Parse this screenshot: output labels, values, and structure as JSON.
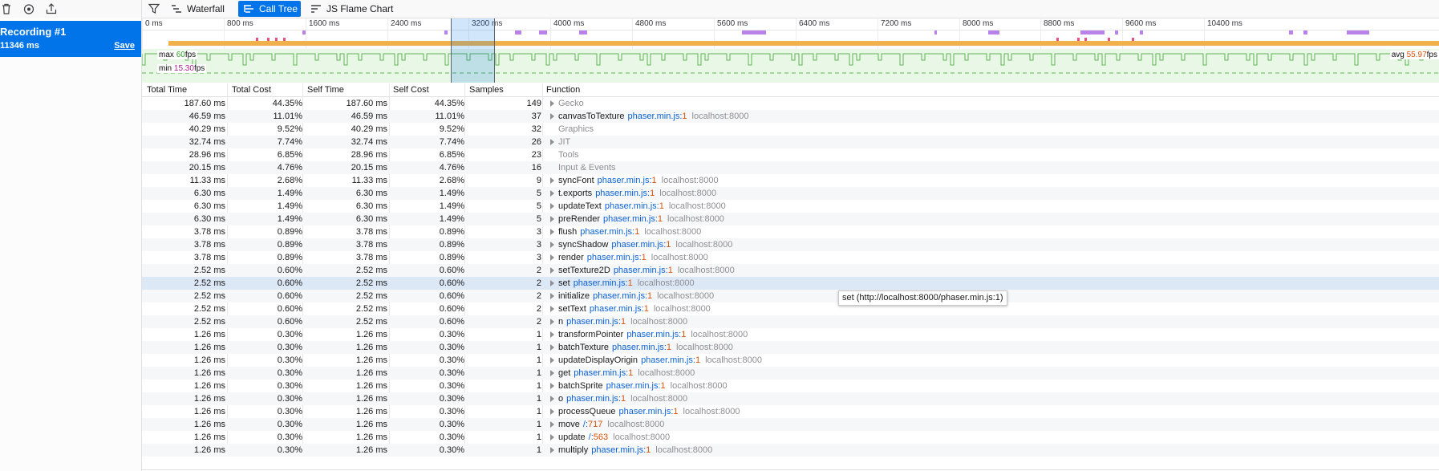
{
  "sidebar": {
    "toolbar_icons": [
      "trash-icon",
      "record-icon",
      "import-icon"
    ],
    "recording": {
      "title": "Recording #1",
      "duration": "11346 ms",
      "save_label": "Save"
    }
  },
  "toolbar": {
    "filter_icon": "filter-icon",
    "tabs": [
      {
        "label": "Waterfall",
        "icon": "waterfall-icon",
        "selected": false
      },
      {
        "label": "Call Tree",
        "icon": "call-tree-icon",
        "selected": true
      },
      {
        "label": "JS Flame Chart",
        "icon": "flame-chart-icon",
        "selected": false
      }
    ]
  },
  "overview": {
    "ticks": [
      "0 ms",
      "800 ms",
      "1600 ms",
      "2400 ms",
      "3200 ms",
      "4000 ms",
      "4800 ms",
      "5600 ms",
      "6400 ms",
      "7200 ms",
      "8000 ms",
      "8800 ms",
      "9600 ms",
      "10400 ms"
    ],
    "fps": {
      "max_label": "max",
      "max_value": "60",
      "min_label": "min",
      "min_value": "15.30",
      "avg_label": "avg",
      "avg_value": "55.97",
      "unit": "fps"
    },
    "selection_start_ms": 3025,
    "selection_end_ms": 3455,
    "colors": {
      "marker_bar": "#f0b14c",
      "marker_purple": "#b982e8",
      "marker_red": "#e5537c",
      "fps_fill": "#e8f7e6",
      "selection": "#0074e8"
    }
  },
  "calltree": {
    "headers": {
      "total_time": "Total Time",
      "total_cost": "Total Cost",
      "self_time": "Self Time",
      "self_cost": "Self Cost",
      "samples": "Samples",
      "function": "Function"
    },
    "rows": [
      {
        "total_time": "187.60 ms",
        "total_cost": "44.35%",
        "self_time": "187.60 ms",
        "self_cost": "44.35%",
        "samples": "149",
        "name": "Gecko",
        "file": "",
        "line": "",
        "host": "",
        "category": true,
        "twisty": true
      },
      {
        "total_time": "46.59 ms",
        "total_cost": "11.01%",
        "self_time": "46.59 ms",
        "self_cost": "11.01%",
        "samples": "37",
        "name": "canvasToTexture",
        "file": "phaser.min.js",
        "line": "1",
        "host": "localhost:8000",
        "category": false,
        "twisty": true
      },
      {
        "total_time": "40.29 ms",
        "total_cost": "9.52%",
        "self_time": "40.29 ms",
        "self_cost": "9.52%",
        "samples": "32",
        "name": "Graphics",
        "file": "",
        "line": "",
        "host": "",
        "category": true,
        "twisty": false
      },
      {
        "total_time": "32.74 ms",
        "total_cost": "7.74%",
        "self_time": "32.74 ms",
        "self_cost": "7.74%",
        "samples": "26",
        "name": "JIT",
        "file": "",
        "line": "",
        "host": "",
        "category": true,
        "twisty": true
      },
      {
        "total_time": "28.96 ms",
        "total_cost": "6.85%",
        "self_time": "28.96 ms",
        "self_cost": "6.85%",
        "samples": "23",
        "name": "Tools",
        "file": "",
        "line": "",
        "host": "",
        "category": true,
        "twisty": false
      },
      {
        "total_time": "20.15 ms",
        "total_cost": "4.76%",
        "self_time": "20.15 ms",
        "self_cost": "4.76%",
        "samples": "16",
        "name": "Input & Events",
        "file": "",
        "line": "",
        "host": "",
        "category": true,
        "twisty": false
      },
      {
        "total_time": "11.33 ms",
        "total_cost": "2.68%",
        "self_time": "11.33 ms",
        "self_cost": "2.68%",
        "samples": "9",
        "name": "syncFont",
        "file": "phaser.min.js",
        "line": "1",
        "host": "localhost:8000",
        "category": false,
        "twisty": true
      },
      {
        "total_time": "6.30 ms",
        "total_cost": "1.49%",
        "self_time": "6.30 ms",
        "self_cost": "1.49%",
        "samples": "5",
        "name": "t.exports",
        "file": "phaser.min.js",
        "line": "1",
        "host": "localhost:8000",
        "category": false,
        "twisty": true
      },
      {
        "total_time": "6.30 ms",
        "total_cost": "1.49%",
        "self_time": "6.30 ms",
        "self_cost": "1.49%",
        "samples": "5",
        "name": "updateText",
        "file": "phaser.min.js",
        "line": "1",
        "host": "localhost:8000",
        "category": false,
        "twisty": true
      },
      {
        "total_time": "6.30 ms",
        "total_cost": "1.49%",
        "self_time": "6.30 ms",
        "self_cost": "1.49%",
        "samples": "5",
        "name": "preRender",
        "file": "phaser.min.js",
        "line": "1",
        "host": "localhost:8000",
        "category": false,
        "twisty": true
      },
      {
        "total_time": "3.78 ms",
        "total_cost": "0.89%",
        "self_time": "3.78 ms",
        "self_cost": "0.89%",
        "samples": "3",
        "name": "flush",
        "file": "phaser.min.js",
        "line": "1",
        "host": "localhost:8000",
        "category": false,
        "twisty": true
      },
      {
        "total_time": "3.78 ms",
        "total_cost": "0.89%",
        "self_time": "3.78 ms",
        "self_cost": "0.89%",
        "samples": "3",
        "name": "syncShadow",
        "file": "phaser.min.js",
        "line": "1",
        "host": "localhost:8000",
        "category": false,
        "twisty": true
      },
      {
        "total_time": "3.78 ms",
        "total_cost": "0.89%",
        "self_time": "3.78 ms",
        "self_cost": "0.89%",
        "samples": "3",
        "name": "render",
        "file": "phaser.min.js",
        "line": "1",
        "host": "localhost:8000",
        "category": false,
        "twisty": true
      },
      {
        "total_time": "2.52 ms",
        "total_cost": "0.60%",
        "self_time": "2.52 ms",
        "self_cost": "0.60%",
        "samples": "2",
        "name": "setTexture2D",
        "file": "phaser.min.js",
        "line": "1",
        "host": "localhost:8000",
        "category": false,
        "twisty": true
      },
      {
        "total_time": "2.52 ms",
        "total_cost": "0.60%",
        "self_time": "2.52 ms",
        "self_cost": "0.60%",
        "samples": "2",
        "name": "set",
        "file": "phaser.min.js",
        "line": "1",
        "host": "localhost:8000",
        "category": false,
        "twisty": true,
        "selected": true
      },
      {
        "total_time": "2.52 ms",
        "total_cost": "0.60%",
        "self_time": "2.52 ms",
        "self_cost": "0.60%",
        "samples": "2",
        "name": "initialize",
        "file": "phaser.min.js",
        "line": "1",
        "host": "localhost:8000",
        "category": false,
        "twisty": true
      },
      {
        "total_time": "2.52 ms",
        "total_cost": "0.60%",
        "self_time": "2.52 ms",
        "self_cost": "0.60%",
        "samples": "2",
        "name": "setText",
        "file": "phaser.min.js",
        "line": "1",
        "host": "localhost:8000",
        "category": false,
        "twisty": true
      },
      {
        "total_time": "2.52 ms",
        "total_cost": "0.60%",
        "self_time": "2.52 ms",
        "self_cost": "0.60%",
        "samples": "2",
        "name": "n",
        "file": "phaser.min.js",
        "line": "1",
        "host": "localhost:8000",
        "category": false,
        "twisty": true
      },
      {
        "total_time": "1.26 ms",
        "total_cost": "0.30%",
        "self_time": "1.26 ms",
        "self_cost": "0.30%",
        "samples": "1",
        "name": "transformPointer",
        "file": "phaser.min.js",
        "line": "1",
        "host": "localhost:8000",
        "category": false,
        "twisty": true
      },
      {
        "total_time": "1.26 ms",
        "total_cost": "0.30%",
        "self_time": "1.26 ms",
        "self_cost": "0.30%",
        "samples": "1",
        "name": "batchTexture",
        "file": "phaser.min.js",
        "line": "1",
        "host": "localhost:8000",
        "category": false,
        "twisty": true
      },
      {
        "total_time": "1.26 ms",
        "total_cost": "0.30%",
        "self_time": "1.26 ms",
        "self_cost": "0.30%",
        "samples": "1",
        "name": "updateDisplayOrigin",
        "file": "phaser.min.js",
        "line": "1",
        "host": "localhost:8000",
        "category": false,
        "twisty": true
      },
      {
        "total_time": "1.26 ms",
        "total_cost": "0.30%",
        "self_time": "1.26 ms",
        "self_cost": "0.30%",
        "samples": "1",
        "name": "get",
        "file": "phaser.min.js",
        "line": "1",
        "host": "localhost:8000",
        "category": false,
        "twisty": true
      },
      {
        "total_time": "1.26 ms",
        "total_cost": "0.30%",
        "self_time": "1.26 ms",
        "self_cost": "0.30%",
        "samples": "1",
        "name": "batchSprite",
        "file": "phaser.min.js",
        "line": "1",
        "host": "localhost:8000",
        "category": false,
        "twisty": true
      },
      {
        "total_time": "1.26 ms",
        "total_cost": "0.30%",
        "self_time": "1.26 ms",
        "self_cost": "0.30%",
        "samples": "1",
        "name": "o",
        "file": "phaser.min.js",
        "line": "1",
        "host": "localhost:8000",
        "category": false,
        "twisty": true
      },
      {
        "total_time": "1.26 ms",
        "total_cost": "0.30%",
        "self_time": "1.26 ms",
        "self_cost": "0.30%",
        "samples": "1",
        "name": "processQueue",
        "file": "phaser.min.js",
        "line": "1",
        "host": "localhost:8000",
        "category": false,
        "twisty": true
      },
      {
        "total_time": "1.26 ms",
        "total_cost": "0.30%",
        "self_time": "1.26 ms",
        "self_cost": "0.30%",
        "samples": "1",
        "name": "move",
        "file": "/",
        "line": "717",
        "host": "localhost:8000",
        "category": false,
        "twisty": true
      },
      {
        "total_time": "1.26 ms",
        "total_cost": "0.30%",
        "self_time": "1.26 ms",
        "self_cost": "0.30%",
        "samples": "1",
        "name": "update",
        "file": "/",
        "line": "563",
        "host": "localhost:8000",
        "category": false,
        "twisty": true
      },
      {
        "total_time": "1.26 ms",
        "total_cost": "0.30%",
        "self_time": "1.26 ms",
        "self_cost": "0.30%",
        "samples": "1",
        "name": "multiply",
        "file": "phaser.min.js",
        "line": "1",
        "host": "localhost:8000",
        "category": false,
        "twisty": true
      }
    ]
  },
  "tooltip": {
    "text": "set (http://localhost:8000/phaser.min.js:1)"
  }
}
